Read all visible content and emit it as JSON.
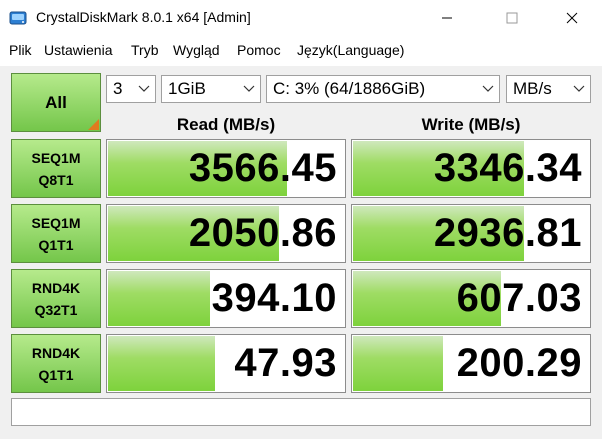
{
  "window": {
    "title": "CrystalDiskMark 8.0.1 x64 [Admin]",
    "min_glyph": "—",
    "max_glyph": "☐",
    "close_glyph": "✕"
  },
  "menu": [
    "Plik",
    "Ustawienia",
    "Tryb",
    "Wygląd",
    "Pomoc",
    "Język(Language)"
  ],
  "controls": {
    "all_label": "All",
    "count": "3",
    "size": "1GiB",
    "drive": "C: 3% (64/1886GiB)",
    "unit": "MB/s"
  },
  "headers": {
    "read": "Read (MB/s)",
    "write": "Write (MB/s)"
  },
  "tests": [
    {
      "line1": "SEQ1M",
      "line2": "Q8T1",
      "read": "3566.45",
      "write": "3346.34",
      "read_fill": 0.75,
      "write_fill": 0.72
    },
    {
      "line1": "SEQ1M",
      "line2": "Q1T1",
      "read": "2050.86",
      "write": "2936.81",
      "read_fill": 0.72,
      "write_fill": 0.72
    },
    {
      "line1": "RND4K",
      "line2": "Q32T1",
      "read": "394.10",
      "write": "607.03",
      "read_fill": 0.43,
      "write_fill": 0.62
    },
    {
      "line1": "RND4K",
      "line2": "Q1T1",
      "read": "47.93",
      "write": "200.29",
      "read_fill": 0.45,
      "write_fill": 0.38
    }
  ],
  "status": "",
  "colors": {
    "bar_green": "#7ed23c",
    "button_green": "#8ed15e",
    "corner_orange": "#e07b1f"
  }
}
